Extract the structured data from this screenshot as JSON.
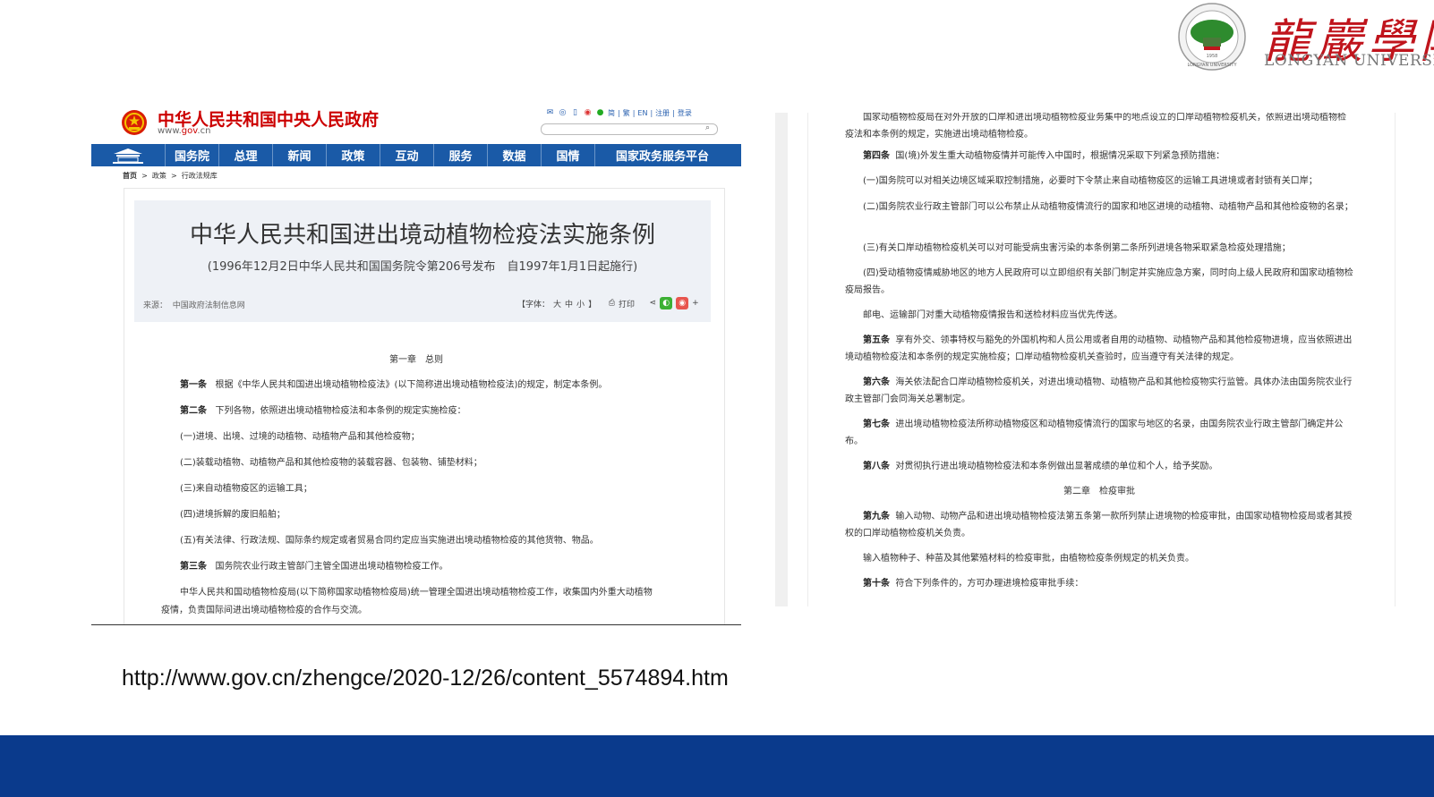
{
  "logo": {
    "cn_name": "龍巖學院",
    "en_name": "LONGYAN UNIVERSITY",
    "seal_year": "1958",
    "seal_text": "LONGYAN UNIVERSITY"
  },
  "gov_site": {
    "site_title": "中华人民共和国中央人民政府",
    "site_url_prefix": "www.",
    "site_url_brand": "gov",
    "site_url_suffix": ".cn",
    "top_links": [
      "简",
      "繁",
      "EN",
      "注册",
      "登录"
    ],
    "top_links_sep": "|",
    "search_placeholder": "",
    "nav_items": [
      "国务院",
      "总理",
      "新闻",
      "政策",
      "互动",
      "服务",
      "数据",
      "国情",
      "国家政务服务平台"
    ],
    "breadcrumb": [
      "首页",
      "政策",
      "行政法规库"
    ],
    "breadcrumb_sep": ">",
    "doc_title": "中华人民共和国进出境动植物检疫法实施条例",
    "doc_subtitle": "(1996年12月2日中华人民共和国国务院令第206号发布　自1997年1月1日起施行)",
    "source_label": "来源：",
    "source_value": "中国政府法制信息网",
    "font_label": "【字体：",
    "font_sizes": [
      "大",
      "中",
      "小"
    ],
    "font_close": "】",
    "print_label": "打印",
    "plus": "+",
    "chapter1": "第一章　总则",
    "articles": [
      {
        "num": "第一条",
        "text": "根据《中华人民共和国进出境动植物检疫法》(以下简称进出境动植物检疫法)的规定，制定本条例。"
      },
      {
        "num": "第二条",
        "text": "下列各物，依照进出境动植物检疫法和本条例的规定实施检疫："
      },
      {
        "num": "",
        "text": "(一)进境、出境、过境的动植物、动植物产品和其他检疫物；"
      },
      {
        "num": "",
        "text": "(二)装载动植物、动植物产品和其他检疫物的装载容器、包装物、铺垫材料；"
      },
      {
        "num": "",
        "text": "(三)来自动植物疫区的运输工具；"
      },
      {
        "num": "",
        "text": "(四)进境拆解的废旧船舶；"
      },
      {
        "num": "",
        "text": "(五)有关法律、行政法规、国际条约规定或者贸易合同约定应当实施进出境动植物检疫的其他货物、物品。"
      },
      {
        "num": "第三条",
        "text": "国务院农业行政主管部门主管全国进出境动植物检疫工作。"
      }
    ],
    "trailing_line1": "中华人民共和国动植物检疫局(以下简称国家动植物检疫局)统一管理全国进出境动植物检疫工作，收集国内外重大动植物",
    "trailing_line2": "疫情，负责国际间进出境动植物检疫的合作与交流。"
  },
  "right_doc": {
    "paragraphs": [
      {
        "num": "",
        "text": "国家动植物检疫局在对外开放的口岸和进出境动植物检疫业务集中的地点设立的口岸动植物检疫机关，依照进出境动植物检疫法和本条例的规定，实施进出境动植物检疫。"
      },
      {
        "num": "第四条",
        "text": "国(境)外发生重大动植物疫情并可能传入中国时，根据情况采取下列紧急预防措施："
      },
      {
        "num": "",
        "text": "(一)国务院可以对相关边境区域采取控制措施，必要时下令禁止来自动植物疫区的运输工具进境或者封锁有关口岸；"
      },
      {
        "num": "",
        "text": "(二)国务院农业行政主管部门可以公布禁止从动植物疫情流行的国家和地区进境的动植物、动植物产品和其他检疫物的名录；"
      },
      {
        "num": "",
        "text": "(三)有关口岸动植物检疫机关可以对可能受病虫害污染的本条例第二条所列进境各物采取紧急检疫处理措施；"
      },
      {
        "num": "",
        "text": "(四)受动植物疫情威胁地区的地方人民政府可以立即组织有关部门制定并实施应急方案，同时向上级人民政府和国家动植物检疫局报告。"
      },
      {
        "num": "",
        "text": "邮电、运输部门对重大动植物疫情报告和送检材料应当优先传送。"
      },
      {
        "num": "第五条",
        "text": "享有外交、领事特权与豁免的外国机构和人员公用或者自用的动植物、动植物产品和其他检疫物进境，应当依照进出境动植物检疫法和本条例的规定实施检疫；口岸动植物检疫机关查验时，应当遵守有关法律的规定。"
      },
      {
        "num": "第六条",
        "text": "海关依法配合口岸动植物检疫机关，对进出境动植物、动植物产品和其他检疫物实行监管。具体办法由国务院农业行政主管部门会同海关总署制定。"
      },
      {
        "num": "第七条",
        "text": "进出境动植物检疫法所称动植物疫区和动植物疫情流行的国家与地区的名录，由国务院农业行政主管部门确定并公布。"
      },
      {
        "num": "第八条",
        "text": "对贯彻执行进出境动植物检疫法和本条例做出显著成绩的单位和个人，给予奖励。"
      },
      {
        "num": "",
        "text": "第二章　检疫审批",
        "center": true
      },
      {
        "num": "第九条",
        "text": "输入动物、动物产品和进出境动植物检疫法第五条第一款所列禁止进境物的检疫审批，由国家动植物检疫局或者其授权的口岸动植物检疫机关负责。"
      },
      {
        "num": "",
        "text": "输入植物种子、种苗及其他繁殖材料的检疫审批，由植物检疫条例规定的机关负责。"
      },
      {
        "num": "第十条",
        "text": "符合下列条件的，方可办理进境检疫审批手续："
      }
    ]
  },
  "caption": {
    "url": "http://www.gov.cn/zhengce/2020-12/26/content_5574894.htm"
  },
  "colors": {
    "gov_red": "#cc0000",
    "nav_blue": "#1a5aa7",
    "footer_blue": "#0a3a8c",
    "logo_red": "#c0141c"
  }
}
